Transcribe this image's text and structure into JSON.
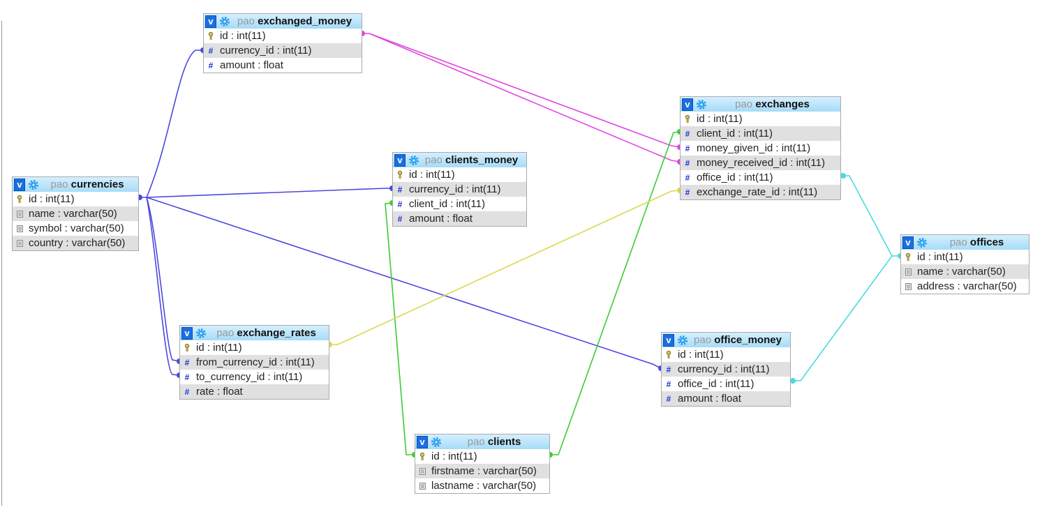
{
  "colors": {
    "fk_currency": "#4b47e0",
    "fk_money": "#e046e0",
    "fk_client": "#3ccc33",
    "fk_rate": "#d9d94e",
    "fk_office": "#47dcdc",
    "header": "#a6dcf7"
  },
  "tables": [
    {
      "id": "exchanged_money",
      "schema": "pao",
      "name": "exchanged_money",
      "columns": [
        {
          "text": "id : int(11)",
          "icon": "key-icon"
        },
        {
          "text": "currency_id : int(11)",
          "icon": "hash-icon"
        },
        {
          "text": "amount : float",
          "icon": "hash-icon"
        }
      ]
    },
    {
      "id": "currencies",
      "schema": "pao",
      "name": "currencies",
      "columns": [
        {
          "text": "id : int(11)",
          "icon": "key-icon"
        },
        {
          "text": "name : varchar(50)",
          "icon": "text-icon"
        },
        {
          "text": "symbol : varchar(50)",
          "icon": "text-icon"
        },
        {
          "text": "country : varchar(50)",
          "icon": "text-icon"
        }
      ]
    },
    {
      "id": "clients_money",
      "schema": "pao",
      "name": "clients_money",
      "columns": [
        {
          "text": "id : int(11)",
          "icon": "key-icon"
        },
        {
          "text": "currency_id : int(11)",
          "icon": "hash-icon"
        },
        {
          "text": "client_id : int(11)",
          "icon": "hash-icon"
        },
        {
          "text": "amount : float",
          "icon": "hash-icon"
        }
      ]
    },
    {
      "id": "exchanges",
      "schema": "pao",
      "name": "exchanges",
      "columns": [
        {
          "text": "id : int(11)",
          "icon": "key-icon"
        },
        {
          "text": "client_id : int(11)",
          "icon": "hash-icon"
        },
        {
          "text": "money_given_id : int(11)",
          "icon": "hash-icon"
        },
        {
          "text": "money_received_id : int(11)",
          "icon": "hash-icon"
        },
        {
          "text": "office_id : int(11)",
          "icon": "hash-icon"
        },
        {
          "text": "exchange_rate_id : int(11)",
          "icon": "hash-icon"
        }
      ]
    },
    {
      "id": "offices",
      "schema": "pao",
      "name": "offices",
      "columns": [
        {
          "text": "id : int(11)",
          "icon": "key-icon"
        },
        {
          "text": "name : varchar(50)",
          "icon": "text-icon"
        },
        {
          "text": "address : varchar(50)",
          "icon": "text-icon"
        }
      ]
    },
    {
      "id": "exchange_rates",
      "schema": "pao",
      "name": "exchange_rates",
      "columns": [
        {
          "text": "id : int(11)",
          "icon": "key-icon"
        },
        {
          "text": "from_currency_id : int(11)",
          "icon": "hash-icon"
        },
        {
          "text": "to_currency_id : int(11)",
          "icon": "hash-icon"
        },
        {
          "text": "rate : float",
          "icon": "hash-icon"
        }
      ]
    },
    {
      "id": "office_money",
      "schema": "pao",
      "name": "office_money",
      "columns": [
        {
          "text": "id : int(11)",
          "icon": "key-icon"
        },
        {
          "text": "currency_id : int(11)",
          "icon": "hash-icon"
        },
        {
          "text": "office_id : int(11)",
          "icon": "hash-icon"
        },
        {
          "text": "amount : float",
          "icon": "hash-icon"
        }
      ]
    },
    {
      "id": "clients",
      "schema": "pao",
      "name": "clients",
      "columns": [
        {
          "text": "id : int(11)",
          "icon": "key-icon"
        },
        {
          "text": "firstname : varchar(50)",
          "icon": "text-icon"
        },
        {
          "text": "lastname : varchar(50)",
          "icon": "text-icon"
        }
      ]
    }
  ],
  "relations": [
    {
      "from": "exchanged_money.currency_id",
      "to": "currencies.id",
      "color": "fk_currency"
    },
    {
      "from": "clients_money.currency_id",
      "to": "currencies.id",
      "color": "fk_currency"
    },
    {
      "from": "office_money.currency_id",
      "to": "currencies.id",
      "color": "fk_currency"
    },
    {
      "from": "exchange_rates.from_currency_id",
      "to": "currencies.id",
      "color": "fk_currency"
    },
    {
      "from": "exchange_rates.to_currency_id",
      "to": "currencies.id",
      "color": "fk_currency"
    },
    {
      "from": "exchanges.money_given_id",
      "to": "exchanged_money.id",
      "color": "fk_money"
    },
    {
      "from": "exchanges.money_received_id",
      "to": "exchanged_money.id",
      "color": "fk_money"
    },
    {
      "from": "clients_money.client_id",
      "to": "clients.id",
      "color": "fk_client"
    },
    {
      "from": "exchanges.client_id",
      "to": "clients.id",
      "color": "fk_client"
    },
    {
      "from": "exchanges.exchange_rate_id",
      "to": "exchange_rates.id",
      "color": "fk_rate"
    },
    {
      "from": "exchanges.office_id",
      "to": "offices.id",
      "color": "fk_office"
    },
    {
      "from": "office_money.office_id",
      "to": "offices.id",
      "color": "fk_office"
    }
  ]
}
